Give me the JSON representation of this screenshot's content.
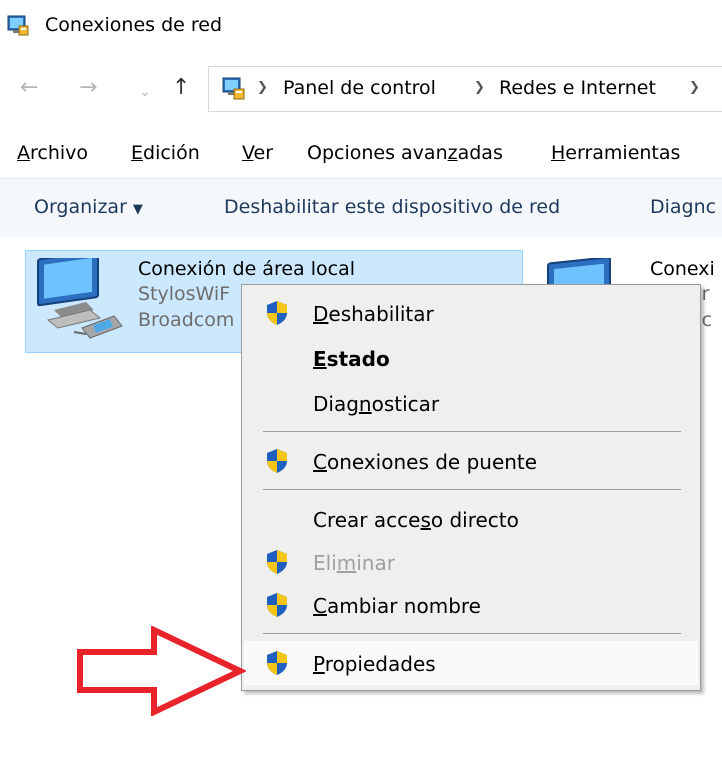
{
  "window": {
    "title": "Conexiones de red"
  },
  "nav": {
    "back_icon": "arrow-left-icon",
    "forward_icon": "arrow-right-icon",
    "recent_icon": "chevron-down-icon",
    "up_icon": "arrow-up-icon",
    "breadcrumbs": [
      "Panel de control",
      "Redes e Internet"
    ]
  },
  "menu": {
    "items": [
      {
        "prefix": "",
        "u": "A",
        "rest": "rchivo"
      },
      {
        "prefix": "",
        "u": "E",
        "rest": "dición"
      },
      {
        "prefix": "",
        "u": "V",
        "rest": "er"
      },
      {
        "prefix": "Opciones avan",
        "u": "z",
        "rest": "adas"
      },
      {
        "prefix": "",
        "u": "H",
        "rest": "erramientas"
      }
    ]
  },
  "commands": {
    "organize": "Organizar",
    "disable_device": "Deshabilitar este dispositivo de red",
    "diagnose": "Diagnc"
  },
  "connections": [
    {
      "name": "Conexión de área local",
      "line2": "StylosWiF",
      "line3": "Broadcom"
    },
    {
      "name": "Conexi",
      "line2": "or",
      "line3": "oc"
    }
  ],
  "context_menu": {
    "items": [
      {
        "pre": "",
        "u": "D",
        "post": "eshabilitar",
        "shield": true
      },
      {
        "pre": "",
        "u": "E",
        "post": "stado",
        "bold": true
      },
      {
        "pre": "Diag",
        "u": "n",
        "post": "osticar"
      },
      {
        "pre": "",
        "u": "C",
        "post": "onexiones de puente",
        "shield": true
      },
      {
        "pre": "Crear acce",
        "u": "s",
        "post": "o directo"
      },
      {
        "pre": "Eli",
        "u": "m",
        "post": "inar",
        "shield": true,
        "disabled": true
      },
      {
        "pre": "",
        "u": "C",
        "post": "ambiar nombre",
        "shield": true
      },
      {
        "pre": "",
        "u": "P",
        "post": "ropiedades",
        "shield": true
      }
    ]
  },
  "colors": {
    "selection_bg": "#cce8ff",
    "selection_border": "#99d1ff",
    "menu_bg": "#eff0ed",
    "command_text": "#1e395b",
    "arrow_red": "#e8232a"
  }
}
